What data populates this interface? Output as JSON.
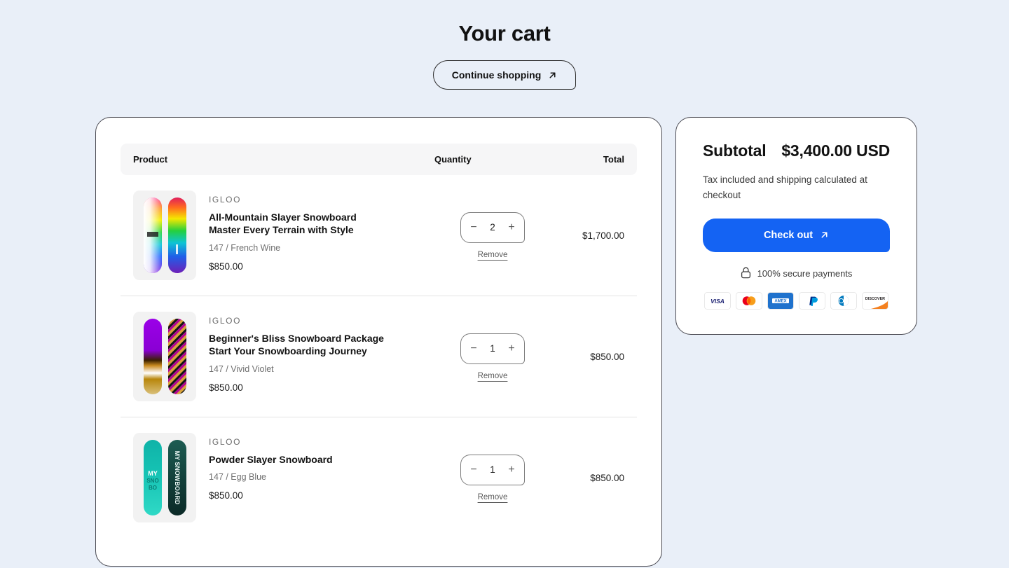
{
  "header": {
    "title": "Your cart",
    "continue_shopping_label": "Continue shopping",
    "continue_shopping_icon": "arrow-up-right-icon"
  },
  "table": {
    "columns": {
      "product": "Product",
      "quantity": "Quantity",
      "total": "Total"
    },
    "decrease_label": "−",
    "increase_label": "+",
    "remove_label": "Remove"
  },
  "items": [
    {
      "vendor": "IGLOO",
      "title": "All-Mountain Slayer Snowboard Master Every Terrain with Style",
      "variant": "147 / French Wine",
      "unit_price": "$850.00",
      "quantity": "2",
      "line_total": "$1,700.00",
      "thumb": "snowboard-rainbow-thumbnail"
    },
    {
      "vendor": "IGLOO",
      "title": "Beginner's Bliss Snowboard Package Start Your Snowboarding Journey",
      "variant": "147 / Vivid Violet",
      "unit_price": "$850.00",
      "quantity": "1",
      "line_total": "$850.00",
      "thumb": "snowboard-violet-thumbnail"
    },
    {
      "vendor": "IGLOO",
      "title": "Powder Slayer Snowboard",
      "variant": "147 / Egg Blue",
      "unit_price": "$850.00",
      "quantity": "1",
      "line_total": "$850.00",
      "thumb": "snowboard-teal-thumbnail"
    }
  ],
  "summary": {
    "subtotal_label": "Subtotal",
    "subtotal_amount": "$3,400.00 USD",
    "tax_note": "Tax included and shipping calculated at checkout",
    "checkout_label": "Check out",
    "checkout_icon": "arrow-up-right-icon",
    "secure_text": "100% secure payments",
    "secure_icon": "lock-icon",
    "payment_methods": [
      "VISA",
      "Mastercard",
      "AMEX",
      "PayPal",
      "Diners Club",
      "DISCOVER"
    ]
  },
  "colors": {
    "page_background": "#e9eff8",
    "accent": "#1463f3",
    "card_border": "#4a4a52",
    "table_head_bg": "#f6f6f7"
  }
}
